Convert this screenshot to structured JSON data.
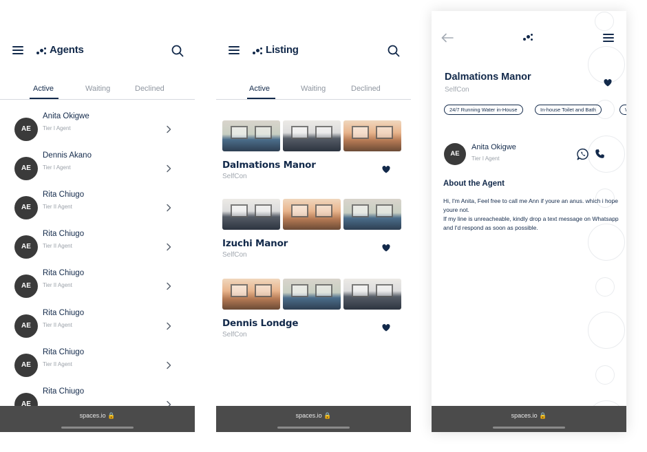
{
  "colors": {
    "primary": "#12294a",
    "muted": "#9aa0a8",
    "avatar_bg": "#3a3a3a",
    "bottom_bar": "#4b4b4b"
  },
  "icons": {
    "menu": "hamburger-icon",
    "logo": "dots-logo-icon",
    "search": "search-icon",
    "chevron": "chevron-right-icon",
    "heart": "heart-icon",
    "back": "arrow-left-icon",
    "whatsapp": "whatsapp-icon",
    "phone": "phone-icon",
    "lock": "lock-icon"
  },
  "agents_screen": {
    "title": "Agents",
    "tabs": [
      "Active",
      "Waiting",
      "Declined"
    ],
    "agents": [
      {
        "initials": "AE",
        "name": "Anita Okigwe",
        "tier": "Tier I Agent"
      },
      {
        "initials": "AE",
        "name": "Dennis Akano",
        "tier": "Tier I Agent"
      },
      {
        "initials": "AE",
        "name": "Rita Chiugo",
        "tier": "Tier II Agent"
      },
      {
        "initials": "AE",
        "name": "Rita Chiugo",
        "tier": "Tier II Agent"
      },
      {
        "initials": "AE",
        "name": "Rita Chiugo",
        "tier": "Tier II Agent"
      },
      {
        "initials": "AE",
        "name": "Rita Chiugo",
        "tier": "Tier II Agent"
      },
      {
        "initials": "AE",
        "name": "Rita Chiugo",
        "tier": "Tier II Agent"
      },
      {
        "initials": "AE",
        "name": "Rita Chiugo",
        "tier": ""
      }
    ],
    "url": "spaces.io 🔒"
  },
  "listing_screen": {
    "title": "Listing",
    "tabs": [
      "Active",
      "Waiting",
      "Declined"
    ],
    "listings": [
      {
        "name": "Dalmations Manor",
        "type": "SelfCon"
      },
      {
        "name": "Izuchi Manor",
        "type": "SelfCon"
      },
      {
        "name": "Dennis Londge",
        "type": "SelfCon"
      }
    ],
    "url": "spaces.io 🔒"
  },
  "detail_screen": {
    "title": "Dalmations Manor",
    "type": "SelfCon",
    "features": [
      "24/7 Running Water in-House",
      "In-house Toilet and Bath",
      "W"
    ],
    "agent": {
      "initials": "AE",
      "name": "Anita Okigwe",
      "tier": "Tier I Agent"
    },
    "about_heading": "About the Agent",
    "about_line1": "Hi, I'm Anita, Feel free to call me Ann if youre an anus. which i hope youre not.",
    "about_line2": "If my line is unreacheable, kindly drop a text message on Whatsapp and I'd respond as soon as possible.",
    "url": "spaces.io 🔒"
  }
}
